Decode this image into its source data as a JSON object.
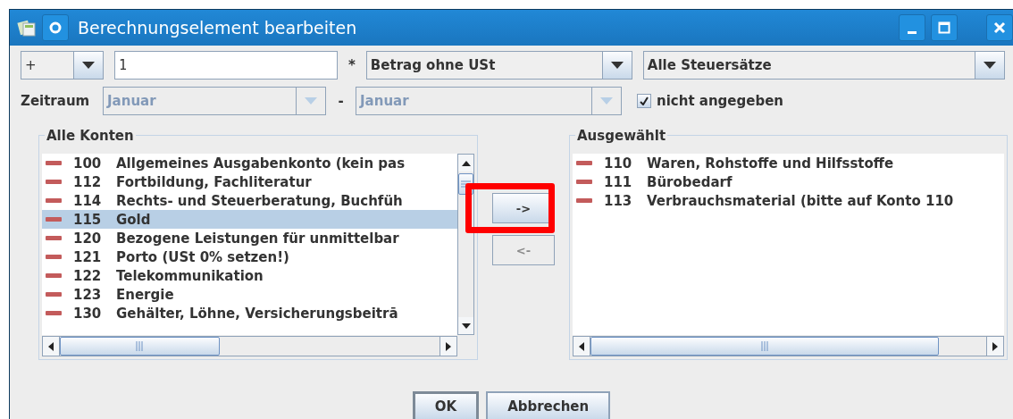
{
  "window": {
    "title": "Berechnungselement bearbeiten"
  },
  "operator": {
    "value": "+"
  },
  "factor": {
    "value": "1"
  },
  "multiply_sign": "*",
  "amount_type": {
    "value": "Betrag ohne USt"
  },
  "tax_rate": {
    "value": "Alle Steuersätze"
  },
  "period": {
    "label": "Zeitraum",
    "from": {
      "value": "Januar",
      "disabled": true
    },
    "separator": "-",
    "to": {
      "value": "Januar",
      "disabled": true
    }
  },
  "not_specified": {
    "label": "nicht angegeben",
    "checked": true
  },
  "all_accounts": {
    "title": "Alle Konten",
    "items": [
      {
        "number": "100",
        "name": "Allgemeines Ausgabenkonto (kein pas",
        "selected": false
      },
      {
        "number": "112",
        "name": "Fortbildung, Fachliteratur",
        "selected": false
      },
      {
        "number": "114",
        "name": "Rechts- und Steuerberatung, Buchfüh",
        "selected": false
      },
      {
        "number": "115",
        "name": "Gold",
        "selected": true
      },
      {
        "number": "120",
        "name": "Bezogene Leistungen für unmittelbar",
        "selected": false
      },
      {
        "number": "121",
        "name": "Porto (USt 0% setzen!)",
        "selected": false
      },
      {
        "number": "122",
        "name": "Telekommunikation",
        "selected": false
      },
      {
        "number": "123",
        "name": "Energie",
        "selected": false
      },
      {
        "number": "130",
        "name": "Gehälter, Löhne, Versicherungsbeitrā",
        "selected": false
      }
    ]
  },
  "move_buttons": [
    {
      "label": "->",
      "disabled": false
    },
    {
      "label": "<-",
      "disabled": true
    }
  ],
  "selected_accounts": {
    "title": "Ausgewählt",
    "items": [
      {
        "number": "110",
        "name": "Waren, Rohstoffe und Hilfsstoffe",
        "selected": false
      },
      {
        "number": "111",
        "name": "Bürobedarf",
        "selected": false
      },
      {
        "number": "113",
        "name": "Verbrauchsmaterial (bitte auf Konto 110",
        "selected": false
      }
    ]
  },
  "buttons": [
    {
      "label": "OK",
      "default": true
    },
    {
      "label": "Abbrechen",
      "default": false
    }
  ]
}
